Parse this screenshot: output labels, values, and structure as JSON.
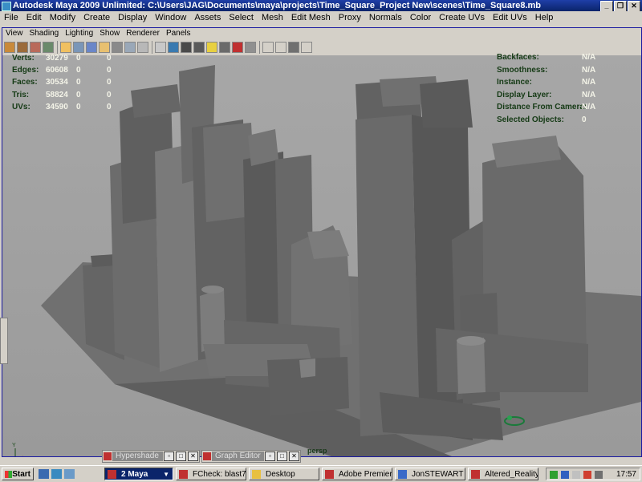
{
  "window": {
    "title": "Autodesk Maya 2009 Unlimited: C:\\Users\\JAG\\Documents\\maya\\projects\\Time_Square_Project New\\scenes\\Time_Square8.mb"
  },
  "menu": [
    "File",
    "Edit",
    "Modify",
    "Create",
    "Display",
    "Window",
    "Assets",
    "Select",
    "Mesh",
    "Edit Mesh",
    "Proxy",
    "Normals",
    "Color",
    "Create UVs",
    "Edit UVs",
    "Help"
  ],
  "panel_menu": [
    "View",
    "Shading",
    "Lighting",
    "Show",
    "Renderer",
    "Panels"
  ],
  "hud_left": [
    {
      "label": "Verts:",
      "a": "30279",
      "b": "0",
      "c": "0"
    },
    {
      "label": "Edges:",
      "a": "60608",
      "b": "0",
      "c": "0"
    },
    {
      "label": "Faces:",
      "a": "30534",
      "b": "0",
      "c": "0"
    },
    {
      "label": "Tris:",
      "a": "58824",
      "b": "0",
      "c": "0"
    },
    {
      "label": "UVs:",
      "a": "34590",
      "b": "0",
      "c": "0"
    }
  ],
  "hud_right": [
    {
      "label": "Backfaces:",
      "value": "N/A"
    },
    {
      "label": "Smoothness:",
      "value": "N/A"
    },
    {
      "label": "Instance:",
      "value": "N/A"
    },
    {
      "label": "Display Layer:",
      "value": "N/A"
    },
    {
      "label": "Distance From Camera:",
      "value": "N/A"
    },
    {
      "label": "Selected Objects:",
      "value": "0"
    }
  ],
  "camera_label": "persp",
  "mini_panels": [
    {
      "title": "Hypershade"
    },
    {
      "title": "Graph Editor"
    }
  ],
  "taskbar": {
    "start_label": "Start",
    "tasks": [
      {
        "label": "2 Maya",
        "active": true
      },
      {
        "label": "FCheck: blast7....",
        "active": false
      },
      {
        "label": "Desktop",
        "active": false
      },
      {
        "label": "Adobe Premiere...",
        "active": false
      },
      {
        "label": "JonSTEWART ...",
        "active": false
      },
      {
        "label": "Altered_Reality_...",
        "active": false
      }
    ],
    "clock": "17:57"
  },
  "colors": {
    "viewport_bg": "#a3a3a3",
    "hud_label": "#153a15",
    "hud_value": "#f4f4e8",
    "title_blue": "#0a246a"
  }
}
